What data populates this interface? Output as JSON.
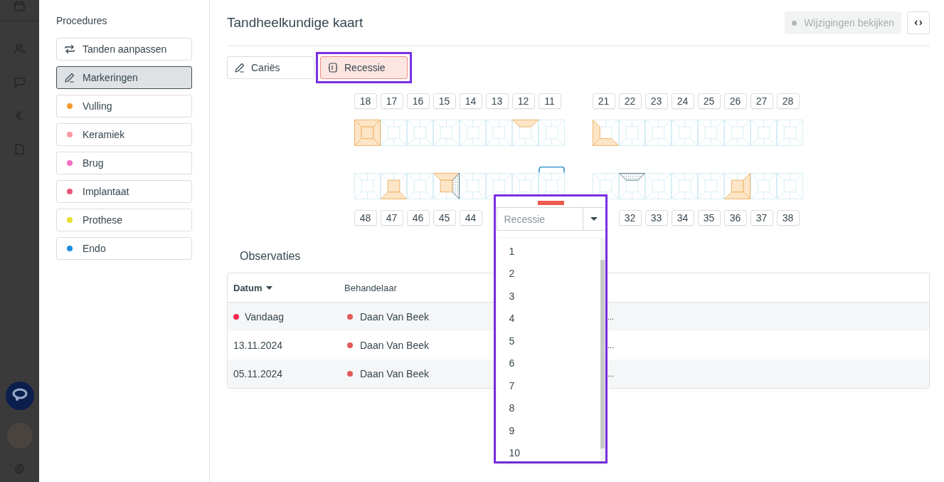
{
  "procedures": {
    "title": "Procedures",
    "items": [
      {
        "label": "Tanden aanpassen",
        "kind": "swap",
        "selected": false
      },
      {
        "label": "Markeringen",
        "kind": "marker",
        "selected": true
      },
      {
        "label": "Vulling",
        "kind": "category",
        "selected": false,
        "color": "#f59a2c"
      },
      {
        "label": "Keramiek",
        "kind": "category",
        "selected": false,
        "color": "#f79a9f"
      },
      {
        "label": "Brug",
        "kind": "category",
        "selected": false,
        "color": "#f56fc2"
      },
      {
        "label": "Implantaat",
        "kind": "category",
        "selected": false,
        "color": "#e8557a"
      },
      {
        "label": "Prothese",
        "kind": "category",
        "selected": false,
        "color": "#e6e02e"
      },
      {
        "label": "Endo",
        "kind": "category",
        "selected": false,
        "color": "#1a8fe0"
      }
    ]
  },
  "header": {
    "title": "Tandheelkundige kaart",
    "review_button": {
      "label": "Wijzigingen bekijken",
      "disabled": true
    }
  },
  "tools": [
    {
      "label": "Cariës",
      "kind": "pencil",
      "selected": false,
      "highlighted": false
    },
    {
      "label": "Recessie",
      "kind": "recession",
      "selected": true,
      "highlighted": true
    }
  ],
  "chart": {
    "upper": [
      [
        {
          "number": "18",
          "selected": false,
          "surfaces": {
            "top": {
              "kind": "filling"
            },
            "bottom": {
              "kind": "filling"
            },
            "left": {
              "kind": "filling"
            },
            "right": {
              "kind": "filling"
            },
            "center": {
              "kind": "filling"
            }
          }
        },
        {
          "number": "17",
          "selected": false
        },
        {
          "number": "16",
          "selected": false
        },
        {
          "number": "15",
          "selected": false
        },
        {
          "number": "14",
          "selected": false
        },
        {
          "number": "13",
          "selected": false
        },
        {
          "number": "12",
          "selected": false,
          "surfaces": {
            "top": {
              "kind": "filling"
            }
          }
        },
        {
          "number": "11",
          "selected": false
        }
      ],
      [
        {
          "number": "21",
          "selected": false,
          "surfaces": {
            "left": {
              "kind": "filling"
            },
            "bottom": {
              "kind": "filling"
            }
          }
        },
        {
          "number": "22",
          "selected": false
        },
        {
          "number": "23",
          "selected": false
        },
        {
          "number": "24",
          "selected": false
        },
        {
          "number": "25",
          "selected": false
        },
        {
          "number": "26",
          "selected": false
        },
        {
          "number": "27",
          "selected": false
        },
        {
          "number": "28",
          "selected": false
        }
      ]
    ],
    "lower": [
      [
        {
          "number": "48",
          "selected": false
        },
        {
          "number": "47",
          "selected": false,
          "surfaces": {
            "center": {
              "kind": "filling"
            },
            "bottom": {
              "kind": "filling"
            }
          }
        },
        {
          "number": "46",
          "selected": false
        },
        {
          "number": "45",
          "selected": false,
          "surfaces": {
            "top": {
              "kind": "filling"
            },
            "center": {
              "kind": "filling"
            },
            "right": {
              "kind": "hatched"
            }
          }
        },
        {
          "number": "44",
          "selected": false
        },
        {
          "selected": false
        },
        {
          "selected": false
        },
        {
          "selected": true
        }
      ],
      [
        {
          "selected": false
        },
        {
          "number": "32",
          "selected": false,
          "surfaces": {
            "top": {
              "kind": "hatched"
            }
          }
        },
        {
          "number": "33",
          "selected": false
        },
        {
          "number": "34",
          "selected": false
        },
        {
          "number": "35",
          "selected": false
        },
        {
          "number": "36",
          "selected": false,
          "surfaces": {
            "center": {
              "kind": "filling"
            },
            "bottom": {
              "kind": "filling"
            },
            "right": {
              "kind": "filling"
            }
          }
        },
        {
          "number": "37",
          "selected": false
        },
        {
          "number": "38",
          "selected": false
        }
      ]
    ]
  },
  "popup": {
    "highlighted": true,
    "select": {
      "placeholder": "Recessie"
    },
    "options": [
      "1",
      "2",
      "3",
      "4",
      "5",
      "6",
      "7",
      "8",
      "9",
      "10"
    ]
  },
  "observations": {
    "title": "Observaties",
    "columns": [
      {
        "label": "Datum",
        "sorted": true
      },
      {
        "label": "Behandelaar",
        "sorted": false
      }
    ],
    "rows": [
      {
        "date": "Vandaag",
        "new": true,
        "practitioner": "Daan Van Beek",
        "color": "#e25a5a",
        "column_3": "..."
      },
      {
        "date": "13.11.2024",
        "new": false,
        "practitioner": "Daan Van Beek",
        "color": "#e25a5a",
        "column_3": "..."
      },
      {
        "date": "05.11.2024",
        "new": false,
        "practitioner": "Daan Van Beek",
        "color": "#e25a5a",
        "column_3": "..."
      }
    ]
  }
}
